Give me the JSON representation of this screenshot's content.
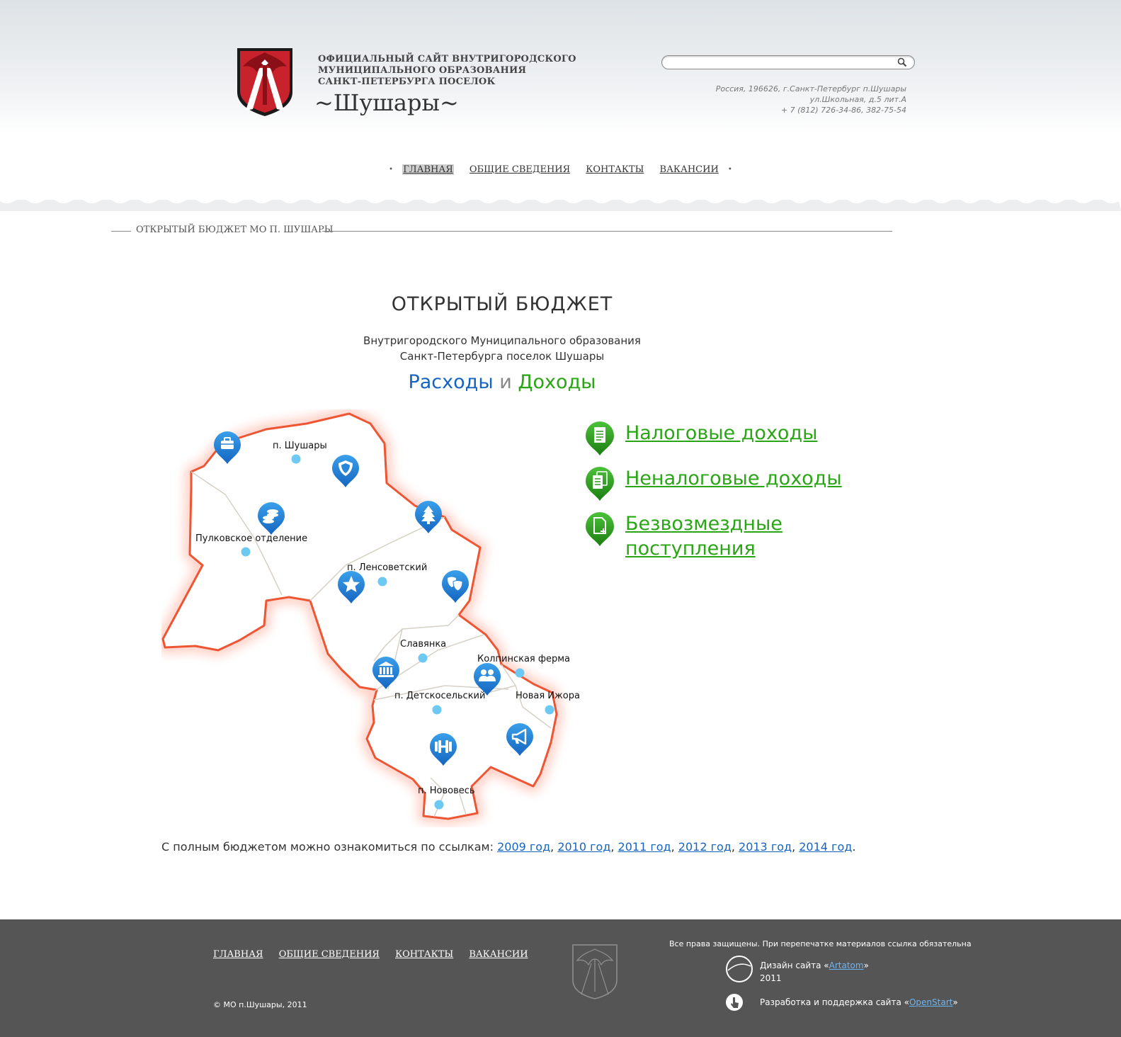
{
  "header": {
    "site_desc_lines": [
      "ОФИЦИАЛЬНЫЙ САЙТ ВНУТРИГОРОДСКОГО",
      "МУНИЦИПАЛЬНОГО ОБРАЗОВАНИЯ",
      "САНКТ-ПЕТЕРБУРГА ПОСЕЛОК"
    ],
    "site_name": "~Шушары~",
    "search_placeholder": "",
    "contacts": [
      "Россия, 196626, г.Санкт-Петербург п.Шушары",
      "ул.Школьная, д.5 лит.А",
      "+ 7 (812) 726-34-86, 382-75-54"
    ]
  },
  "nav": {
    "items": [
      {
        "label": "ГЛАВНАЯ",
        "active": true
      },
      {
        "label": "ОБЩИЕ СВЕДЕНИЯ"
      },
      {
        "label": "КОНТАКТЫ"
      },
      {
        "label": "ВАКАНСИИ"
      }
    ]
  },
  "breadcrumb": "ОТКРЫТЫЙ БЮДЖЕТ МО П. ШУШАРЫ",
  "main": {
    "title": "ОТКРЫТЫЙ БЮДЖЕТ",
    "subtitle_lines": [
      "Внутригородского Муниципального образования",
      "Санкт-Петербурга поселок Шушары"
    ],
    "expenses_label": "Расходы",
    "and_label": "и",
    "incomes_label": "Доходы"
  },
  "map": {
    "places": [
      "п. Шушары",
      "Пулковское отделение",
      "п. Ленсоветский",
      "Славянка",
      "Колпинская ферма",
      "п. Детскосельский",
      "Новая Ижора",
      "п. Нововесь"
    ],
    "pin_icons": [
      "briefcase-icon",
      "shield-icon",
      "coins-icon",
      "tree-icon",
      "star-icon",
      "theatre-masks-icon",
      "museum-icon",
      "people-icon",
      "dumbbell-icon",
      "megaphone-icon"
    ],
    "accent_color": "#1e88d8",
    "border_color": "#ee5533"
  },
  "income_links": [
    "Налоговые доходы",
    "Неналоговые доходы",
    "Безвозмездные поступления"
  ],
  "income_color": "#2aa516",
  "full_budget": {
    "prefix": "С полным бюджетом можно ознакомиться по ссылкам:",
    "years": [
      "2009 год",
      "2010 год",
      "2011 год",
      "2012 год",
      "2013 год",
      "2014 год"
    ]
  },
  "footer": {
    "nav": [
      "ГЛАВНАЯ",
      "ОБЩИЕ СВЕДЕНИЯ",
      "КОНТАКТЫ",
      "ВАКАНСИИ"
    ],
    "copyright": "©  МО п.Шушары, 2011",
    "rights": "Все права защищены. При перепечатке материалов ссылка обязательна",
    "design_prefix": "Дизайн сайта «",
    "design_link": "Artatom",
    "design_suffix": "»",
    "design_year": "2011",
    "dev_prefix": "Разработка и поддержка сайта «",
    "dev_link": "OpenStart",
    "dev_suffix": "»"
  }
}
